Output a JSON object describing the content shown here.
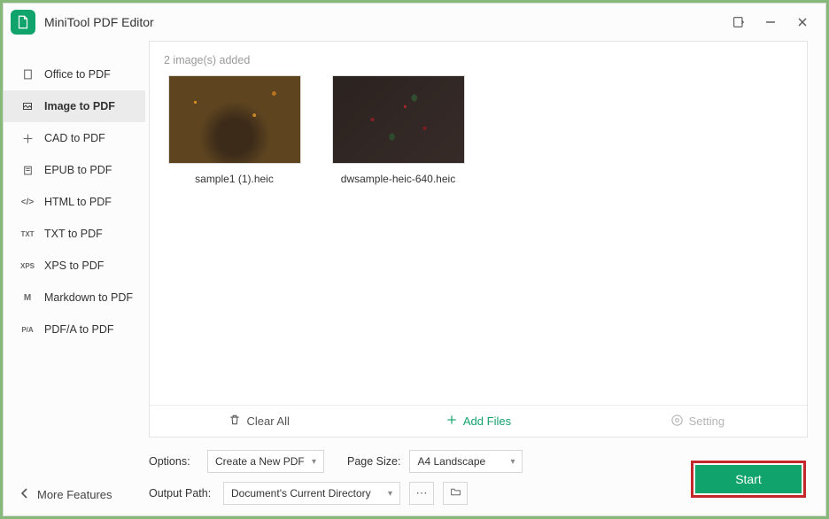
{
  "app": {
    "title": "MiniTool PDF Editor"
  },
  "sidebar": {
    "items": [
      {
        "label": "Office to PDF",
        "icon": "doc"
      },
      {
        "label": "Image to PDF",
        "icon": "img",
        "active": true
      },
      {
        "label": "CAD to PDF",
        "icon": "cad"
      },
      {
        "label": "EPUB to PDF",
        "icon": "epub"
      },
      {
        "label": "HTML to PDF",
        "icon": "html"
      },
      {
        "label": "TXT to PDF",
        "icon": "TXT"
      },
      {
        "label": "XPS to PDF",
        "icon": "XPS"
      },
      {
        "label": "Markdown to PDF",
        "icon": "M"
      },
      {
        "label": "PDF/A to PDF",
        "icon": "P/A"
      }
    ],
    "more": "More Features"
  },
  "panel": {
    "status": "2 image(s) added",
    "files": [
      {
        "name": "sample1 (1).heic"
      },
      {
        "name": "dwsample-heic-640.heic"
      }
    ],
    "actions": {
      "clear": "Clear All",
      "add": "Add Files",
      "setting": "Setting"
    }
  },
  "options": {
    "options_label": "Options:",
    "options_value": "Create a New PDF",
    "pagesize_label": "Page Size:",
    "pagesize_value": "A4 Landscape",
    "output_label": "Output Path:",
    "output_value": "Document's Current Directory"
  },
  "start": {
    "label": "Start"
  }
}
